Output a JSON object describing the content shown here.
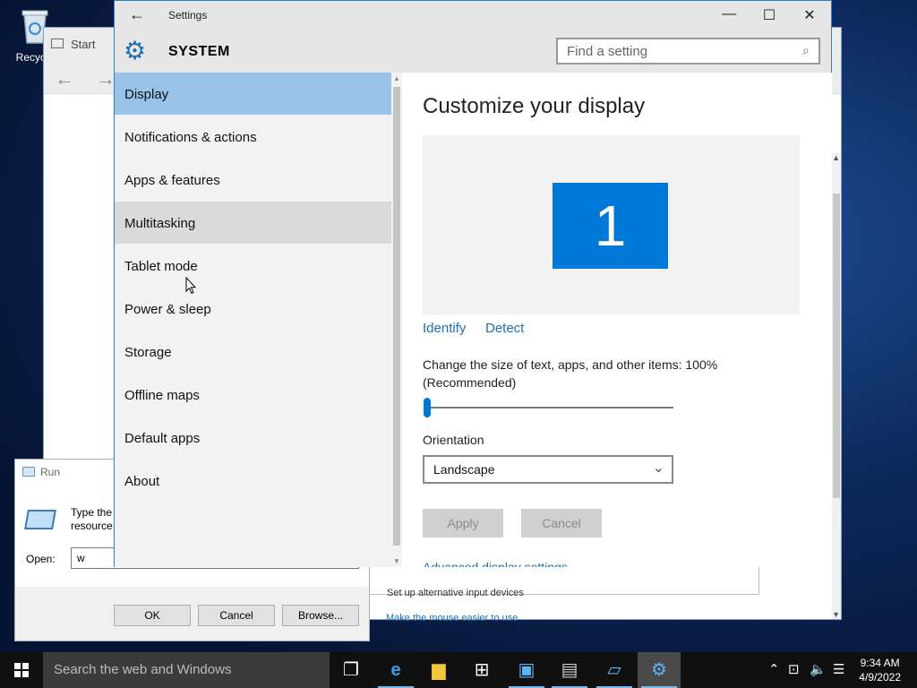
{
  "desktop": {
    "recycle_label": "Recycle"
  },
  "start_window": {
    "title": "Start"
  },
  "behind_panel": {
    "text": "Set up alternative input devices",
    "link": "Make the mouse easier to use"
  },
  "run": {
    "title": "Run",
    "desc_line1": "Type the",
    "desc_line2": "resource,",
    "open_label": "Open:",
    "input_value": "w",
    "ok_label": "OK",
    "cancel_label": "Cancel",
    "browse_label": "Browse..."
  },
  "settings": {
    "title": "Settings",
    "section": "SYSTEM",
    "search_placeholder": "Find a setting",
    "nav": [
      {
        "label": "Display",
        "state": "active"
      },
      {
        "label": "Notifications & actions",
        "state": ""
      },
      {
        "label": "Apps & features",
        "state": ""
      },
      {
        "label": "Multitasking",
        "state": "hover"
      },
      {
        "label": "Tablet mode",
        "state": ""
      },
      {
        "label": "Power & sleep",
        "state": ""
      },
      {
        "label": "Storage",
        "state": ""
      },
      {
        "label": "Offline maps",
        "state": ""
      },
      {
        "label": "Default apps",
        "state": ""
      },
      {
        "label": "About",
        "state": ""
      }
    ],
    "content": {
      "title": "Customize your display",
      "monitor_number": "1",
      "identify": "Identify",
      "detect": "Detect",
      "scale_label_line1": "Change the size of text, apps, and other items: 100%",
      "scale_label_line2": "(Recommended)",
      "scale_fraction": 0.0,
      "orientation_label": "Orientation",
      "orientation_value": "Landscape",
      "apply": "Apply",
      "cancel": "Cancel",
      "more": "Advanced display settings"
    }
  },
  "taskbar": {
    "search_placeholder": "Search the web and Windows",
    "time": "9:34 AM",
    "date": "4/9/2022"
  },
  "colors": {
    "accent": "#0078d7",
    "nav_selected": "#99c2e8"
  }
}
